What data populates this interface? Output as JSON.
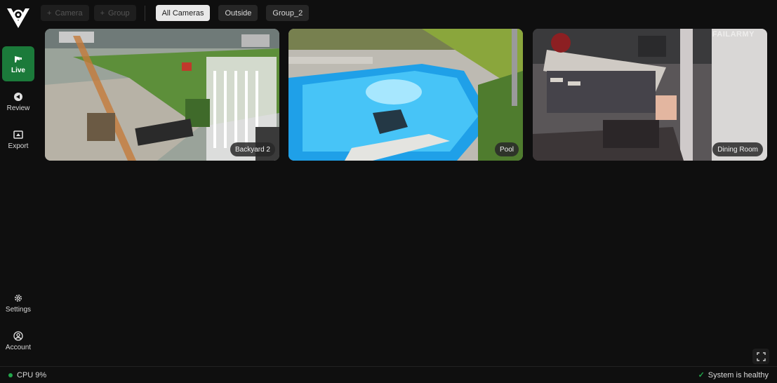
{
  "sidebar": {
    "nav": [
      {
        "label": "Live",
        "icon": "live-icon",
        "active": true
      },
      {
        "label": "Review",
        "icon": "review-icon",
        "active": false
      },
      {
        "label": "Export",
        "icon": "export-icon",
        "active": false
      }
    ],
    "bottom": [
      {
        "label": "Settings",
        "icon": "gear-icon"
      },
      {
        "label": "Account",
        "icon": "account-icon"
      }
    ]
  },
  "toolbar": {
    "add_camera": "Camera",
    "add_group": "Group",
    "groups": [
      "All Cameras",
      "Outside",
      "Group_2"
    ],
    "selected_group": "All Cameras"
  },
  "cameras": [
    {
      "name": "Backyard 2"
    },
    {
      "name": "Pool"
    },
    {
      "name": "Dining Room",
      "watermark": "FAILARMY"
    }
  ],
  "status": {
    "cpu": "CPU 9%",
    "health": "System is healthy"
  },
  "colors": {
    "accent": "#1b7a3a",
    "healthy": "#22a64b",
    "background": "#0f0f0f"
  }
}
